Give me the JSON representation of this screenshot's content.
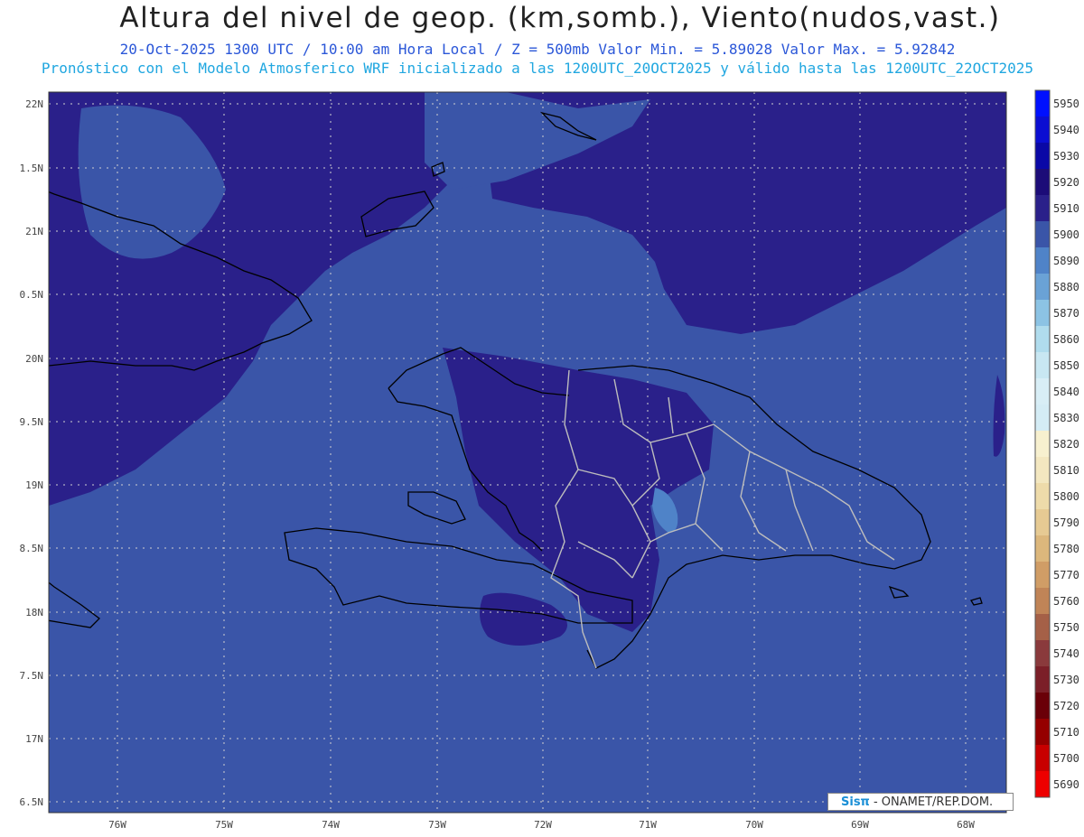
{
  "header": {
    "title": "Altura del nivel de geop. (km,somb.), Viento(nudos,vast.)",
    "subtitle": "20-Oct-2025  1300 UTC / 10:00 am Hora Local / Z = 500mb   Valor Min. = 5.89028  Valor Max. = 5.92842",
    "forecast_line": "Pronóstico con el Modelo Atmosferico WRF inicializado a las 1200UTC_20OCT2025 y válido hasta las  1200UTC_22OCT2025"
  },
  "map": {
    "lat_labels": [
      "22N",
      "1.5N",
      "21N",
      "0.5N",
      "20N",
      "9.5N",
      "19N",
      "8.5N",
      "18N",
      "7.5N",
      "17N",
      "6.5N"
    ],
    "lon_labels": [
      "76W",
      "75W",
      "74W",
      "73W",
      "72W",
      "71W",
      "70W",
      "69W",
      "68W"
    ],
    "colors": {
      "base_fill": "#3a55a8",
      "high_fill": "#2a208a",
      "light_fill": "#4f83c8",
      "coast": "#000000",
      "border": "#bdbdbd",
      "grid": "#d0d0d0"
    }
  },
  "colorbar": {
    "labels": [
      "5950",
      "5940",
      "5930",
      "5920",
      "5910",
      "5900",
      "5890",
      "5880",
      "5870",
      "5860",
      "5850",
      "5840",
      "5830",
      "5820",
      "5810",
      "5800",
      "5790",
      "5780",
      "5770",
      "5760",
      "5750",
      "5740",
      "5730",
      "5720",
      "5710",
      "5700",
      "5690"
    ],
    "colors": [
      "#0010ff",
      "#0b0ed2",
      "#0a08a6",
      "#1c0c78",
      "#2a208a",
      "#3a55a8",
      "#4f83c8",
      "#6aa2d6",
      "#8cc3e4",
      "#b0dced",
      "#c8e7f2",
      "#d8eef6",
      "#d4ecf5",
      "#f7f0cf",
      "#f3e7c0",
      "#eedbaa",
      "#e6ca93",
      "#dcb77c",
      "#d09d66",
      "#c08457",
      "#a56047",
      "#8a3a3c",
      "#7b1f28",
      "#6a0008",
      "#950000",
      "#c80000",
      "#ee0000"
    ]
  },
  "credit": {
    "brand": "Sisπ",
    "text": "- ONAMET/REP.DOM."
  }
}
